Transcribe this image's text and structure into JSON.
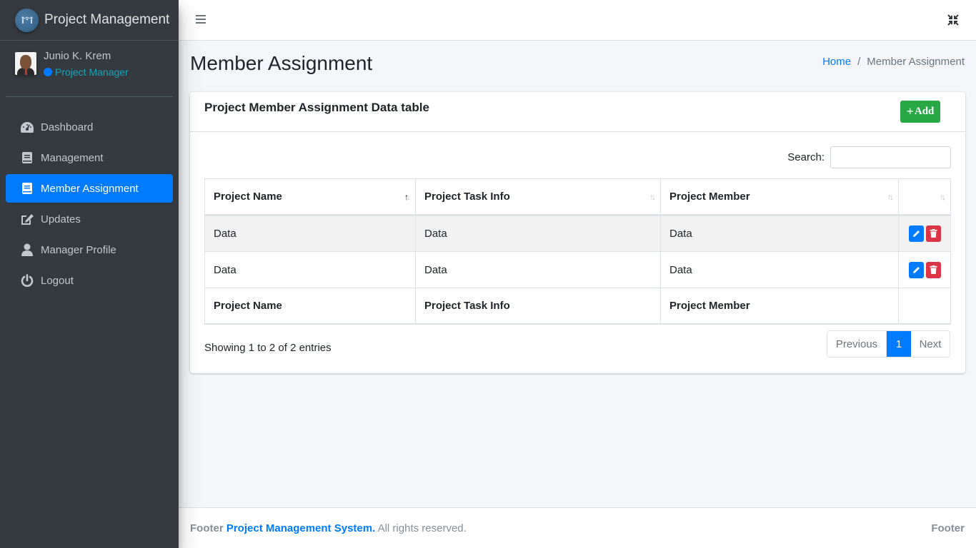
{
  "app": {
    "brand_title": "Project Management"
  },
  "user": {
    "name": "Junio K. Krem",
    "role": "Project Manager",
    "role_dot_color": "#007bff"
  },
  "sidebar": {
    "items": [
      {
        "label": "Dashboard",
        "icon": "tachometer-icon",
        "active": false
      },
      {
        "label": "Management",
        "icon": "book-icon",
        "active": false
      },
      {
        "label": "Member Assignment",
        "icon": "book-icon",
        "active": true
      },
      {
        "label": "Updates",
        "icon": "edit-icon",
        "active": false
      },
      {
        "label": "Manager Profile",
        "icon": "user-icon",
        "active": false
      },
      {
        "label": "Logout",
        "icon": "power-icon",
        "active": false
      }
    ]
  },
  "header": {
    "page_title": "Member Assignment",
    "breadcrumb": {
      "home": "Home",
      "separator": "/",
      "current": "Member Assignment"
    }
  },
  "card": {
    "title": "Project Member Assignment Data table",
    "add_button": {
      "icon": "+",
      "label": "Add"
    },
    "search": {
      "label": "Search:",
      "value": "",
      "placeholder": ""
    },
    "table": {
      "columns": [
        "Project Name",
        "Project Task Info",
        "Project Member",
        ""
      ],
      "sorted_column": 0,
      "sort_direction": "ascending",
      "rows": [
        [
          "Data",
          "Data",
          "Data"
        ],
        [
          "Data",
          "Data",
          "Data"
        ]
      ],
      "footer": [
        "Project Name",
        "Project Task Info",
        "Project Member",
        ""
      ]
    },
    "info": "Showing 1 to 2 of 2 entries",
    "pagination": {
      "previous": "Previous",
      "pages": [
        "1"
      ],
      "current_page": "1",
      "next": "Next"
    }
  },
  "footer": {
    "prefix": "Footer",
    "brand": "Project Management System.",
    "suffix": "All rights reserved.",
    "right": "Footer"
  },
  "colors": {
    "primary": "#007bff",
    "success": "#28a745",
    "danger": "#dc3545",
    "sidebar_bg": "#343a40",
    "info": "#17a2b8"
  }
}
